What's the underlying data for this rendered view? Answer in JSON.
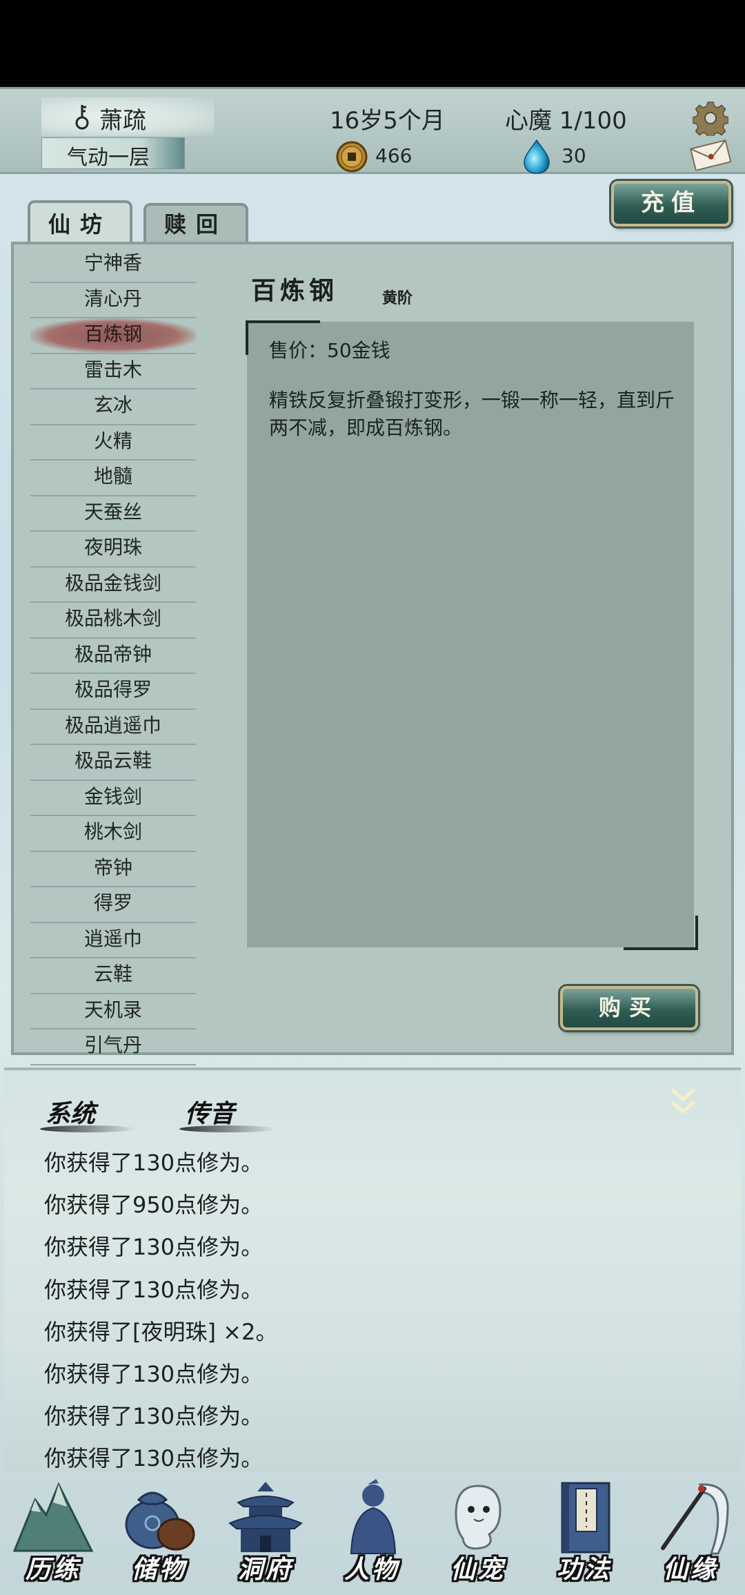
{
  "header": {
    "name": "萧疏",
    "realm": "气动一层",
    "age": "16岁5个月",
    "heart_demon": "心魔  1/100",
    "coins": "466",
    "spirit_stones": "30"
  },
  "recharge_label": "充值",
  "tabs": [
    {
      "label": "仙坊",
      "active": true
    },
    {
      "label": "赎回",
      "active": false
    }
  ],
  "items": [
    "宁神香",
    "清心丹",
    "百炼钢",
    "雷击木",
    "玄冰",
    "火精",
    "地髓",
    "天蚕丝",
    "夜明珠",
    "极品金钱剑",
    "极品桃木剑",
    "极品帝钟",
    "极品得罗",
    "极品逍遥巾",
    "极品云鞋",
    "金钱剑",
    "桃木剑",
    "帝钟",
    "得罗",
    "逍遥巾",
    "云鞋",
    "天机录",
    "引气丹"
  ],
  "selected_item": 2,
  "detail": {
    "title": "百炼钢",
    "grade": "黄阶",
    "price": "售价：50金钱",
    "description": "精铁反复折叠锻打变形，一锻一称一轻，直到斤两不减，即成百炼钢。"
  },
  "buy_label": "购买",
  "messages": {
    "tab_system": "系统",
    "tab_whisper": "传音",
    "lines": [
      "你获得了130点修为。",
      "你获得了950点修为。",
      "你获得了130点修为。",
      "你获得了130点修为。",
      "你获得了[夜明珠] ×2。",
      "你获得了130点修为。",
      "你获得了130点修为。",
      "你获得了130点修为。"
    ]
  },
  "nav": [
    {
      "label": "历练",
      "icon": "mountain-icon"
    },
    {
      "label": "储物",
      "icon": "storage-bag-icon"
    },
    {
      "label": "洞府",
      "icon": "pagoda-icon"
    },
    {
      "label": "人物",
      "icon": "character-icon"
    },
    {
      "label": "仙宠",
      "icon": "spirit-pet-icon"
    },
    {
      "label": "功法",
      "icon": "scripture-book-icon"
    },
    {
      "label": "仙缘",
      "icon": "crane-icon"
    }
  ],
  "colors": {
    "panel": "#b4c6c1",
    "desc_box": "#92a69e",
    "selected_item": "#9b625f",
    "button": "#2f5e55",
    "button_border": "#c9b88a"
  }
}
